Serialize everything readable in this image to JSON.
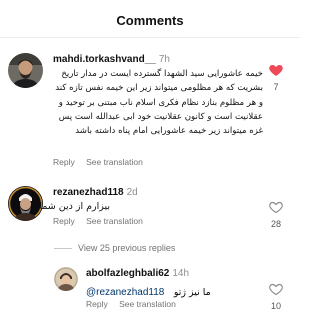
{
  "header": {
    "title": "Comments"
  },
  "comments": [
    {
      "username": "mahdi.torkashvand__",
      "time": "7h",
      "text": "خیمه عاشورایی سید الشهدا گسترده ایست در مدار تاریخ بشریت که هر مظلومی میتواند زیر این خیمه نفس تازه کند و هر مظلوم بنازد نظام فکری اسلام ناب مبتنی بر توحید و عقلانیت است و کانون عقلانیت خود ابی عبدالله است پس غزه میتواند زیر خیمه عاشورایی امام پناه داشته باشد",
      "reply_label": "Reply",
      "see_translation_label": "See translation",
      "likes": "7",
      "liked": true
    },
    {
      "username": "rezanezhad118",
      "time": "2d",
      "text": "بیزارم از دین شما",
      "reply_label": "Reply",
      "see_translation_label": "See translation",
      "likes": "28",
      "liked": false
    }
  ],
  "view_replies_label": "View 25 previous replies",
  "reply": {
    "username": "abolfazleghbali62",
    "time": "14h",
    "mention": "@rezanezhad118",
    "text": "ما نیز ژتو",
    "reply_label": "Reply",
    "see_translation_label": "See translation",
    "likes": "10",
    "liked": false
  },
  "colors": {
    "liked_heart": "#ed4956",
    "mention": "#00376b",
    "muted": "#737373"
  }
}
